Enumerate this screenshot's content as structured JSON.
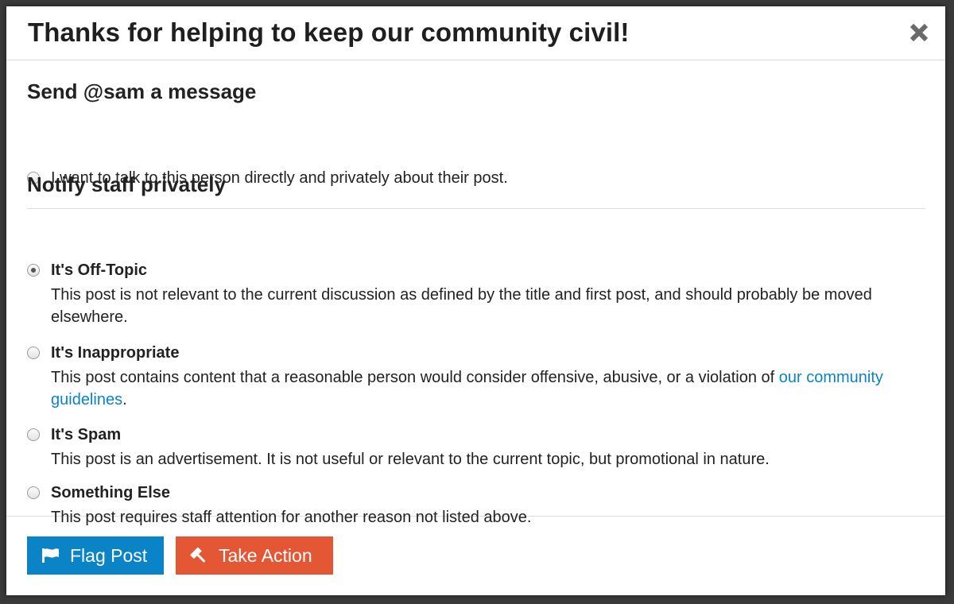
{
  "modal": {
    "title": "Thanks for helping to keep our community civil!",
    "close_icon": "close-x-icon"
  },
  "message_section": {
    "title": "Send @sam a message",
    "option_label": "I want to talk to this person directly and privately about their post.",
    "checked": false
  },
  "notify_section": {
    "title": "Notify staff privately",
    "options": [
      {
        "label": "It's Off-Topic",
        "description": "This post is not relevant to the current discussion as defined by the title and first post, and should probably be moved elsewhere.",
        "checked": true
      },
      {
        "label": "It's Inappropriate",
        "description_before": "This post contains content that a reasonable person would consider offensive, abusive, or a violation of ",
        "link_text": "our community guidelines",
        "description_after": ".",
        "checked": false
      },
      {
        "label": "It's Spam",
        "description": "This post is an advertisement. It is not useful or relevant to the current topic, but promotional in nature.",
        "checked": false
      },
      {
        "label": "Something Else",
        "description": "This post requires staff attention for another reason not listed above.",
        "checked": false
      }
    ]
  },
  "footer": {
    "flag_button": {
      "label": "Flag Post",
      "icon": "flag-icon",
      "color": "#0a84c6"
    },
    "action_button": {
      "label": "Take Action",
      "icon": "gavel-icon",
      "color": "#e45735"
    }
  },
  "colors": {
    "link": "#0a84c6",
    "text": "#222222"
  }
}
